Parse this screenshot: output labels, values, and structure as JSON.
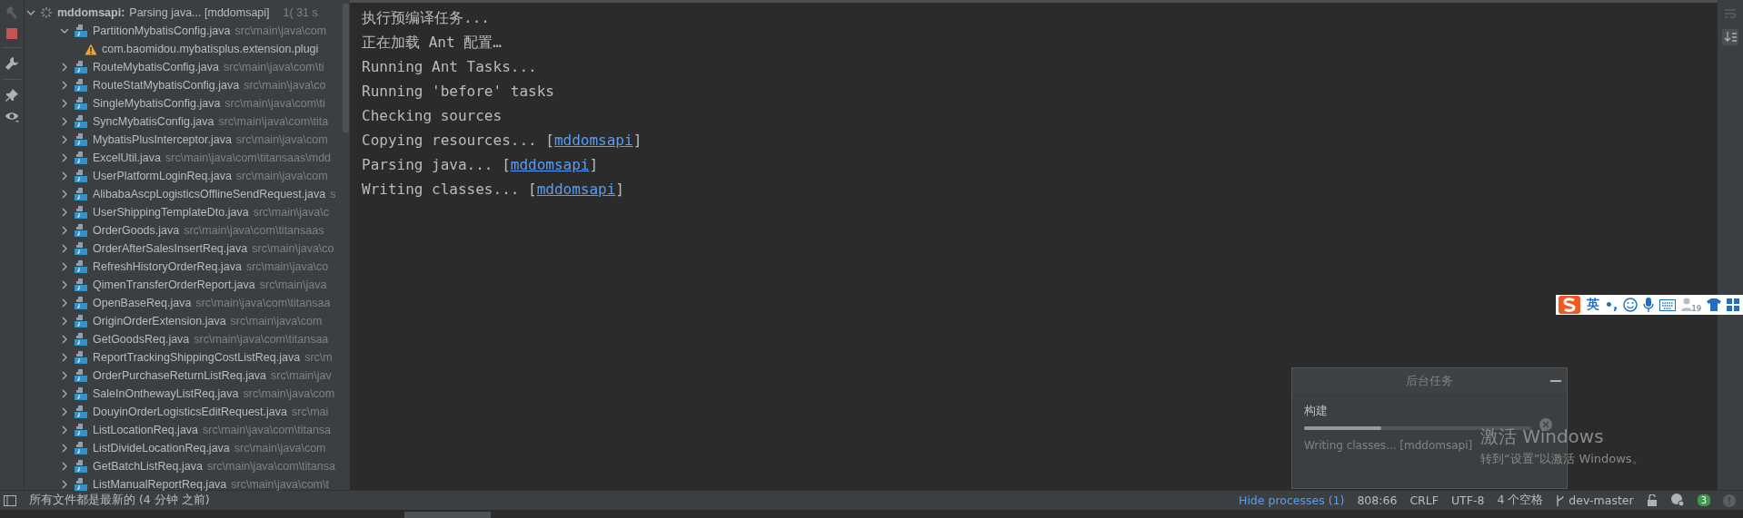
{
  "tree": {
    "kind": "module",
    "name": "mddomsapi:",
    "status": "Parsing java... [mddomsapi]",
    "time": "1( 31 s",
    "expanded": true,
    "children": [
      {
        "kind": "file",
        "name": "PartitionMybatisConfig.java",
        "path": "src\\main\\java\\com",
        "expanded": true,
        "children": [
          {
            "kind": "warning",
            "name": "com.baomidou.mybatisplus.extension.plugi"
          }
        ]
      },
      {
        "kind": "file",
        "name": "RouteMybatisConfig.java",
        "path": "src\\main\\java\\com\\ti",
        "expanded": false
      },
      {
        "kind": "file",
        "name": "RouteStatMybatisConfig.java",
        "path": "src\\main\\java\\co",
        "expanded": false
      },
      {
        "kind": "file",
        "name": "SingleMybatisConfig.java",
        "path": "src\\main\\java\\com\\ti",
        "expanded": false
      },
      {
        "kind": "file",
        "name": "SyncMybatisConfig.java",
        "path": "src\\main\\java\\com\\tita",
        "expanded": false
      },
      {
        "kind": "file",
        "name": "MybatisPlusInterceptor.java",
        "path": "src\\main\\java\\com",
        "expanded": false
      },
      {
        "kind": "file",
        "name": "ExcelUtil.java",
        "path": "src\\main\\java\\com\\titansaas\\mdd",
        "expanded": false
      },
      {
        "kind": "file",
        "name": "UserPlatformLoginReq.java",
        "path": "src\\main\\java\\com",
        "expanded": false
      },
      {
        "kind": "file",
        "name": "AlibabaAscpLogisticsOfflineSendRequest.java",
        "path": "s",
        "expanded": false
      },
      {
        "kind": "file",
        "name": "UserShippingTemplateDto.java",
        "path": "src\\main\\java\\c",
        "expanded": false
      },
      {
        "kind": "file",
        "name": "OrderGoods.java",
        "path": "src\\main\\java\\com\\titansaas",
        "expanded": false
      },
      {
        "kind": "file",
        "name": "OrderAfterSalesInsertReq.java",
        "path": "src\\main\\java\\co",
        "expanded": false
      },
      {
        "kind": "file",
        "name": "RefreshHistoryOrderReq.java",
        "path": "src\\main\\java\\co",
        "expanded": false
      },
      {
        "kind": "file",
        "name": "QimenTransferOrderReport.java",
        "path": "src\\main\\java",
        "expanded": false
      },
      {
        "kind": "file",
        "name": "OpenBaseReq.java",
        "path": "src\\main\\java\\com\\titansaa",
        "expanded": false
      },
      {
        "kind": "file",
        "name": "OriginOrderExtension.java",
        "path": "src\\main\\java\\com",
        "expanded": false
      },
      {
        "kind": "file",
        "name": "GetGoodsReq.java",
        "path": "src\\main\\java\\com\\titansaa",
        "expanded": false
      },
      {
        "kind": "file",
        "name": "ReportTrackingShippingCostListReq.java",
        "path": "src\\m",
        "expanded": false
      },
      {
        "kind": "file",
        "name": "OrderPurchaseReturnListReq.java",
        "path": "src\\main\\jav",
        "expanded": false
      },
      {
        "kind": "file",
        "name": "SaleInOnthewayListReq.java",
        "path": "src\\main\\java\\com",
        "expanded": false
      },
      {
        "kind": "file",
        "name": "DouyinOrderLogisticsEditRequest.java",
        "path": "src\\mai",
        "expanded": false
      },
      {
        "kind": "file",
        "name": "ListLocationReq.java",
        "path": "src\\main\\java\\com\\titansa",
        "expanded": false
      },
      {
        "kind": "file",
        "name": "ListDivideLocationReq.java",
        "path": "src\\main\\java\\com",
        "expanded": false
      },
      {
        "kind": "file",
        "name": "GetBatchListReq.java",
        "path": "src\\main\\java\\com\\titansa",
        "expanded": false
      },
      {
        "kind": "file",
        "name": "ListManualReportReq.java",
        "path": "src\\main\\java\\com\\t",
        "expanded": false
      }
    ]
  },
  "console": [
    {
      "text": "执行预编译任务..."
    },
    {
      "text": "正在加载 Ant 配置…"
    },
    {
      "text": "Running Ant Tasks..."
    },
    {
      "text": "Running 'before' tasks"
    },
    {
      "text": "Checking sources"
    },
    {
      "text": "Copying resources... [",
      "link": "mddomsapi",
      "suffix": "]"
    },
    {
      "text": "Parsing java... [",
      "link": "mddomsapi",
      "suffix": "]"
    },
    {
      "text": "Writing classes... [",
      "link": "mddomsapi",
      "suffix": "]"
    }
  ],
  "ime_toolbar": {
    "language": "英",
    "punct": "•,",
    "badge": "19"
  },
  "background_tasks": {
    "title": "后台任务",
    "task": "构建",
    "level": 0.34,
    "detail": "Writing classes... [mddomsapi]"
  },
  "activation": {
    "title": "激活 Windows",
    "hint": "转到“设置”以激活 Windows。"
  },
  "status_bar": {
    "message": "所有文件都是最新的 (4 分钟 之前)",
    "processes": "Hide processes (1)",
    "position": "808:66",
    "line_sep": "CRLF",
    "encoding": "UTF-8",
    "indent": "4 个空格",
    "branch": "dev-master",
    "notifications": "3"
  }
}
